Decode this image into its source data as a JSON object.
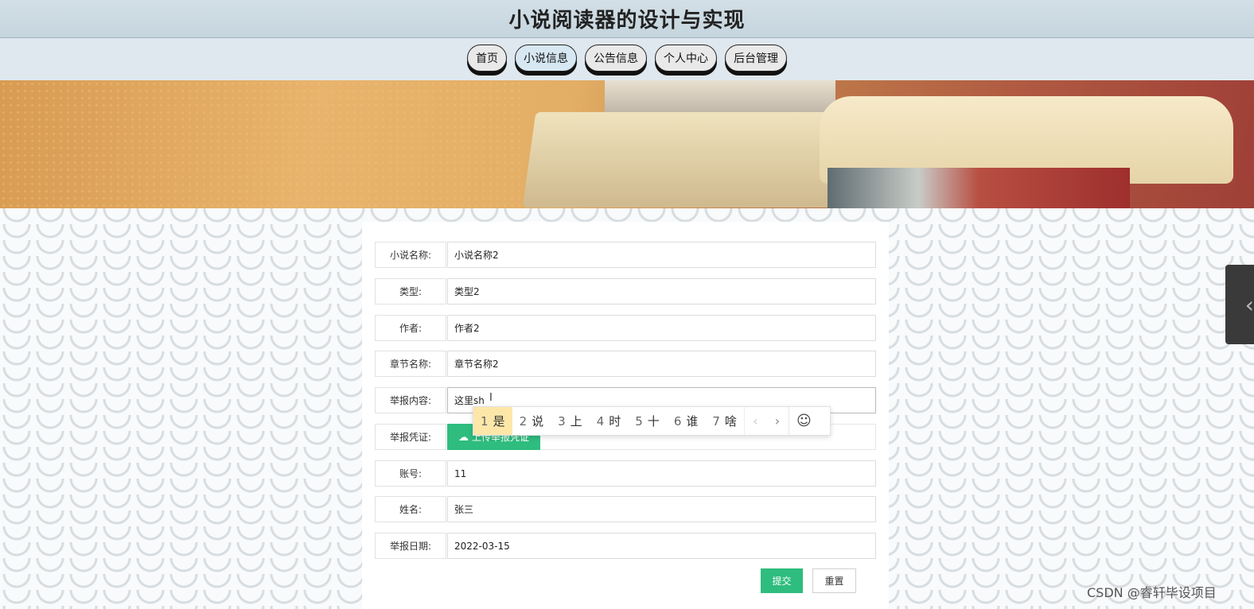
{
  "site": {
    "title": "小说阅读器的设计与实现"
  },
  "nav": {
    "items": [
      {
        "label": "首页",
        "active": false
      },
      {
        "label": "小说信息",
        "active": true
      },
      {
        "label": "公告信息",
        "active": false
      },
      {
        "label": "个人中心",
        "active": false
      },
      {
        "label": "后台管理",
        "active": false
      }
    ]
  },
  "form": {
    "fields": [
      {
        "label": "小说名称:",
        "value": "小说名称2"
      },
      {
        "label": "类型:",
        "value": "类型2"
      },
      {
        "label": "作者:",
        "value": "作者2"
      },
      {
        "label": "章节名称:",
        "value": "章节名称2"
      },
      {
        "label": "举报内容:",
        "value": "这里sh"
      },
      {
        "label": "举报凭证:",
        "upload_label": "上传举报凭证"
      },
      {
        "label": "账号:",
        "value": "11"
      },
      {
        "label": "姓名:",
        "value": "张三"
      },
      {
        "label": "举报日期:",
        "value": "2022-03-15"
      }
    ],
    "submit_label": "提交",
    "reset_label": "重置"
  },
  "ime": {
    "candidates": [
      {
        "num": "1",
        "text": "是"
      },
      {
        "num": "2",
        "text": "说"
      },
      {
        "num": "3",
        "text": "上"
      },
      {
        "num": "4",
        "text": "时"
      },
      {
        "num": "5",
        "text": "十"
      },
      {
        "num": "6",
        "text": "谁"
      },
      {
        "num": "7",
        "text": "啥"
      }
    ],
    "prev": "‹",
    "next": "›",
    "emoji": "☺"
  },
  "side_tab": {
    "icon": "‹"
  },
  "watermark": "CSDN @睿轩毕设项目",
  "colors": {
    "accent_green": "#2ebd7e",
    "ime_selected": "#fde7a8"
  }
}
